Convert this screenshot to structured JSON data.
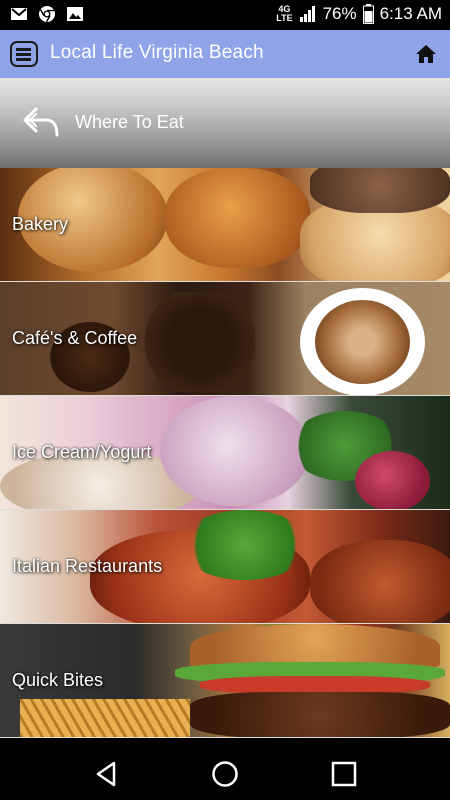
{
  "status_bar": {
    "network": "4G",
    "network_sub": "LTE",
    "battery": "76%",
    "time": "6:13 AM",
    "icons": [
      "gmail-icon",
      "chrome-icon",
      "gallery-icon",
      "signal-icon",
      "battery-icon"
    ]
  },
  "app_bar": {
    "title": "Local Life Virginia Beach",
    "accent": "#8fa3e8",
    "menu_icon": "menu-icon",
    "home_icon": "home-icon"
  },
  "section": {
    "title": "Where To Eat",
    "back_icon": "back-arrow-icon"
  },
  "categories": [
    {
      "label": "Bakery"
    },
    {
      "label": "Café's & Coffee"
    },
    {
      "label": "Ice Cream/Yogurt"
    },
    {
      "label": "Italian Restaurants"
    },
    {
      "label": "Quick Bites"
    }
  ],
  "nav_bar": {
    "icons": [
      "back-triangle-icon",
      "home-circle-icon",
      "recents-square-icon"
    ]
  }
}
